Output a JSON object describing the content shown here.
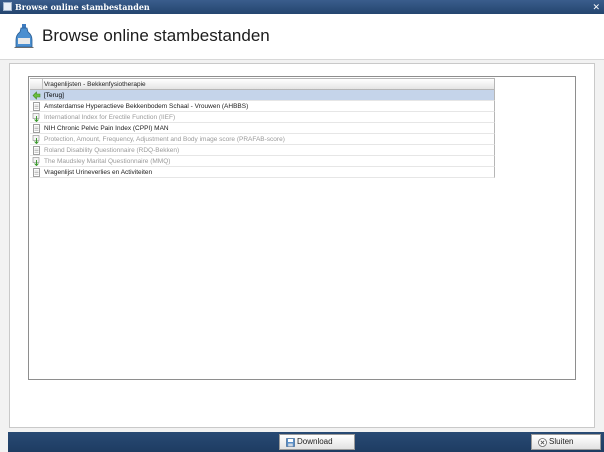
{
  "window": {
    "title": "Browse online stambestanden"
  },
  "header": {
    "title": "Browse online stambestanden"
  },
  "list": {
    "column_header": "Vragenlijsten - Bekkenfysiotherapie",
    "rows": [
      {
        "label": "[Terug]",
        "icon": "back-arrow-icon",
        "state": "selected"
      },
      {
        "label": "Amsterdamse Hyperactieve Bekkenbodem Schaal - Vrouwen (AHBBS)",
        "icon": "document-icon",
        "state": "active"
      },
      {
        "label": "International Index for Erectile Function (IIEF)",
        "icon": "download-icon",
        "state": "inactive"
      },
      {
        "label": "NIH Chronic Pelvic Pain Index (CPPI) MAN",
        "icon": "document-icon",
        "state": "active"
      },
      {
        "label": "Protection, Amount, Frequency, Adjustment and Body image score (PRAFAB-score)",
        "icon": "download-icon",
        "state": "inactive"
      },
      {
        "label": "Roland Disability Questionnaire (RDQ-Bekken)",
        "icon": "document-icon",
        "state": "inactive"
      },
      {
        "label": "The Maudsley Marital Questionnaire (MMQ)",
        "icon": "download-icon",
        "state": "inactive"
      },
      {
        "label": "Vragenlijst Urineverlies en Activiteiten",
        "icon": "document-icon",
        "state": "active"
      }
    ]
  },
  "footer": {
    "download_label": "Download",
    "close_label": "Sluiten"
  },
  "colors": {
    "titlebar": "#2c4f7c",
    "footer": "#24446b",
    "selected_row": "#c5d4ea",
    "inactive_text": "#9a9a9a"
  }
}
